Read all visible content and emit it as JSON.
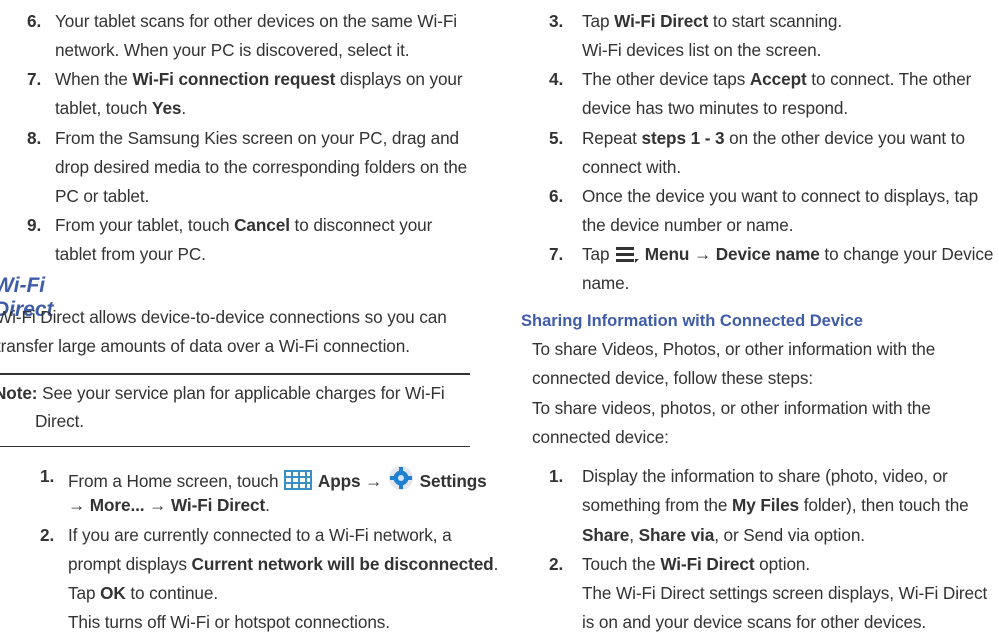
{
  "left": {
    "s6": {
      "n": "6.",
      "a": "Your tablet scans for other devices on the same Wi-Fi",
      "b": "network. When your PC is discovered, select it."
    },
    "s7": {
      "n": "7.",
      "a1": "When the ",
      "a_bold": "Wi-Fi connection request",
      "a2": " displays on your",
      "b1": "tablet, touch ",
      "b_bold": "Yes",
      "b2": "."
    },
    "s8": {
      "n": "8.",
      "a": "From the Samsung Kies screen on your PC, drag and",
      "b": "drop desired media to the corresponding folders on the",
      "c": "PC or tablet."
    },
    "s9": {
      "n": "9.",
      "a1": "From your tablet, touch ",
      "a_bold": "Cancel",
      "a2": " to disconnect your",
      "b": "tablet from your PC."
    },
    "heading": "Wi-Fi Direct",
    "intro_a": "Wi-Fi Direct allows device-to-device connections so you can",
    "intro_b": "transfer large amounts of data over a Wi-Fi connection.",
    "note_label": "Note:",
    "note_a": " See your service plan for applicable charges for Wi-Fi",
    "note_b": "Direct.",
    "s1": {
      "n": "1.",
      "a1": "From a Home screen, touch ",
      "apps": "Apps",
      "arrow": "→",
      "settings": "Settings",
      "b_more": "More...",
      "b_wifi": "Wi-Fi Direct",
      "b_end": "."
    },
    "s2": {
      "n": "2.",
      "a": "If you are currently connected to a Wi-Fi network, a",
      "b1": "prompt displays ",
      "b_bold": "Current network will be disconnected",
      "b2": ".",
      "c1": "Tap ",
      "c_bold": "OK",
      "c2": " to continue.",
      "d": "This turns off Wi-Fi or hotspot connections."
    }
  },
  "right": {
    "s3": {
      "n": "3.",
      "a1": "Tap ",
      "a_bold": "Wi-Fi Direct",
      "a2": " to start scanning.",
      "b": "Wi-Fi devices list on the screen."
    },
    "s4": {
      "n": "4.",
      "a1": "The other device taps ",
      "a_bold": "Accept",
      "a2": " to connect. The other",
      "b": "device has two minutes to respond."
    },
    "s5": {
      "n": "5.",
      "a1": "Repeat ",
      "a_bold": "steps 1 - 3",
      "a2": " on the other device you want to",
      "b": "connect with."
    },
    "s6": {
      "n": "6.",
      "a": "Once the device you want to connect to displays, tap",
      "b": "the device number or name."
    },
    "s7": {
      "n": "7.",
      "a1": "Tap ",
      "menu": "Menu",
      "arrow": "→",
      "devname": "Device name",
      "a2": " to change your Device",
      "b": "name."
    },
    "subheading": "Sharing Information with Connected Device",
    "p1a": "To share Videos, Photos, or other information with the",
    "p1b": "connected device, follow these steps:",
    "p2a": "To share videos, photos, or other information with the",
    "p2b": "connected device:",
    "t1": {
      "n": "1.",
      "a": "Display the information to share (photo, video, or",
      "b1": "something from the ",
      "b_bold": "My Files",
      "b2": " folder), then touch the",
      "c_share": "Share",
      "c_sep": ", ",
      "c_sharevia": "Share via",
      "c_end": ", or Send via option."
    },
    "t2": {
      "n": "2.",
      "a1": "Touch the ",
      "a_bold": "Wi-Fi Direct",
      "a2": " option.",
      "b": "The Wi-Fi Direct settings screen displays, Wi-Fi Direct",
      "c": "is on and your device scans for other devices."
    }
  },
  "colors": {
    "heading": "#3f5ca8",
    "text": "#333333",
    "icon_grid": "#3a8fc4",
    "settings_blue": "#1f7fd0"
  }
}
